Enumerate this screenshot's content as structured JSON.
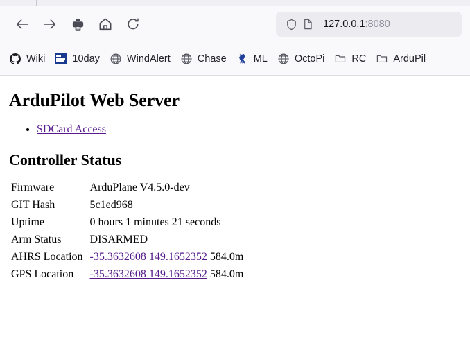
{
  "browser": {
    "toolbar_buttons": [
      {
        "name": "back-button",
        "icon": "arrow-left-icon"
      },
      {
        "name": "forward-button",
        "icon": "arrow-right-icon"
      },
      {
        "name": "print-button",
        "icon": "printer-icon"
      },
      {
        "name": "home-button",
        "icon": "home-icon"
      },
      {
        "name": "reload-button",
        "icon": "reload-icon"
      }
    ],
    "url": {
      "host": "127.0.0.1",
      "port": ":8080",
      "shield_icon": "shield-icon",
      "page_icon": "page-document-icon"
    },
    "bookmarks": [
      {
        "label": "Wiki",
        "icon": "github-icon"
      },
      {
        "label": "10day",
        "icon": "weather-channel-icon"
      },
      {
        "label": "WindAlert",
        "icon": "globe-icon"
      },
      {
        "label": "Chase",
        "icon": "globe-icon"
      },
      {
        "label": "ML",
        "icon": "ing-lion-icon"
      },
      {
        "label": "OctoPi",
        "icon": "globe-icon"
      },
      {
        "label": "RC",
        "icon": "folder-icon"
      },
      {
        "label": "ArduPil",
        "icon": "folder-icon"
      }
    ]
  },
  "page": {
    "heading": "ArduPilot Web Server",
    "links": [
      {
        "label": "SDCard Access"
      }
    ],
    "status_heading": "Controller Status",
    "status_rows": [
      {
        "label": "Firmware",
        "value": "ArduPlane V4.5.0-dev",
        "link": false
      },
      {
        "label": "GIT Hash",
        "value": "5c1ed968",
        "link": false
      },
      {
        "label": "Uptime",
        "value": "0 hours 1 minutes 21 seconds",
        "link": false
      },
      {
        "label": "Arm Status",
        "value": "DISARMED",
        "link": false
      },
      {
        "label": "AHRS Location",
        "value": "-35.3632608 149.1652352",
        "link": true,
        "suffix": "584.0m"
      },
      {
        "label": "GPS Location",
        "value": "-35.3632608 149.1652352",
        "link": true,
        "suffix": "584.0m"
      }
    ]
  },
  "colors": {
    "chrome_bg": "#f9f9fb",
    "urlbar_bg": "#ececf0",
    "link_visited": "#551a8b",
    "bookmark_blue": "#1a3a8f",
    "text": "#15141a"
  }
}
